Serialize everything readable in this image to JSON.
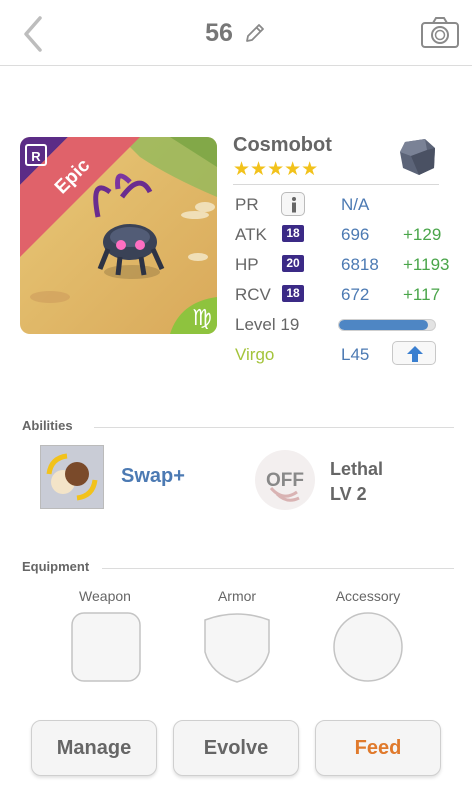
{
  "header": {
    "number": "56"
  },
  "monster": {
    "name": "Cosmobot",
    "stars": "★★★★★",
    "rarity": "Epic",
    "rarity_icon_text": "R",
    "zodiac_symbol": "♍"
  },
  "stats": {
    "pr": {
      "label": "PR",
      "value": "N/A"
    },
    "atk": {
      "label": "ATK",
      "plus": "18",
      "value": "696",
      "bonus": "+129"
    },
    "hp": {
      "label": "HP",
      "plus": "20",
      "value": "6818",
      "bonus": "+1193"
    },
    "rcv": {
      "label": "RCV",
      "plus": "18",
      "value": "672",
      "bonus": "+117"
    },
    "level": {
      "label": "Level 19",
      "progress": 0.93
    },
    "zodiac": {
      "label": "Virgo",
      "level": "L45"
    }
  },
  "abilities": {
    "title": "Abilities",
    "skill": "Swap+",
    "awaken_status": "OFF",
    "awaken_name": "Lethal",
    "awaken_level": "LV 2"
  },
  "equipment": {
    "title": "Equipment",
    "slots": [
      "Weapon",
      "Armor",
      "Accessory"
    ]
  },
  "actions": {
    "manage": "Manage",
    "evolve": "Evolve",
    "feed": "Feed"
  },
  "colors": {
    "accent_blue": "#4c7ab3",
    "bonus_green": "#4aa54a",
    "rarity_red": "#e0626a",
    "feed_orange": "#e07a2c"
  }
}
